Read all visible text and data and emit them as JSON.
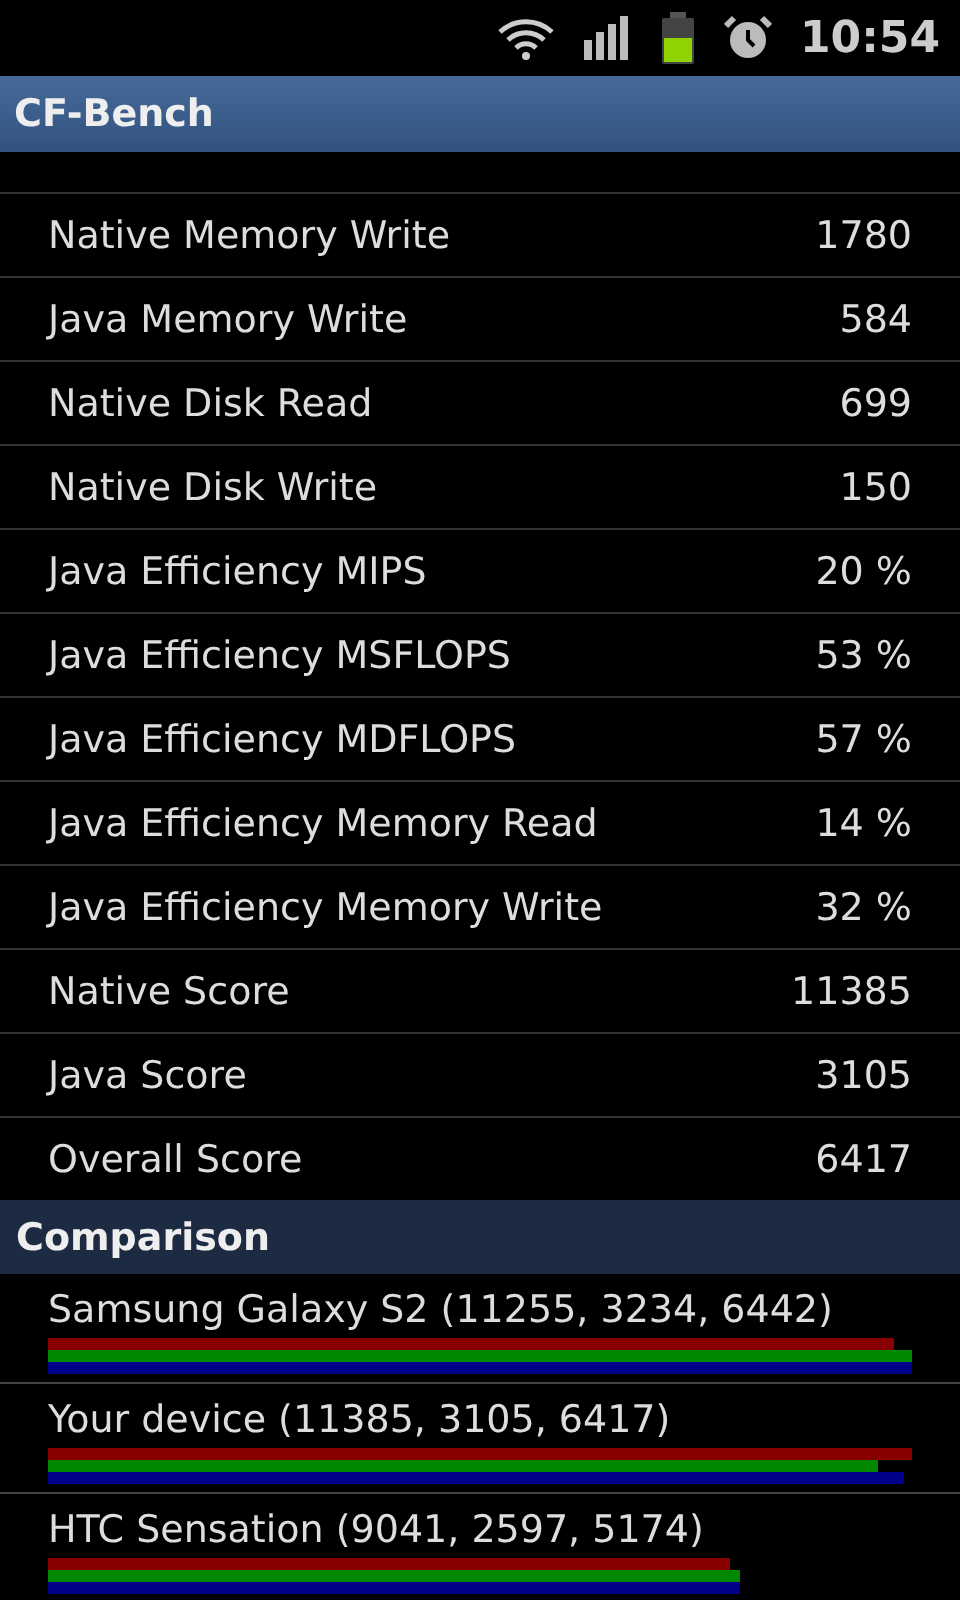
{
  "status_bar": {
    "time": "10:54"
  },
  "app_bar": {
    "title": "CF-Bench"
  },
  "results": [
    {
      "label": "Native Memory Write",
      "value": "1780"
    },
    {
      "label": "Java Memory Write",
      "value": "584"
    },
    {
      "label": "Native Disk Read",
      "value": "699"
    },
    {
      "label": "Native Disk Write",
      "value": "150"
    },
    {
      "label": "Java Efficiency MIPS",
      "value": "20 %"
    },
    {
      "label": "Java Efficiency MSFLOPS",
      "value": "53 %"
    },
    {
      "label": "Java Efficiency MDFLOPS",
      "value": "57 %"
    },
    {
      "label": "Java Efficiency Memory Read",
      "value": "14 %"
    },
    {
      "label": "Java Efficiency Memory Write",
      "value": "32 %"
    },
    {
      "label": "Native Score",
      "value": "11385"
    },
    {
      "label": "Java Score",
      "value": "3105"
    },
    {
      "label": "Overall Score",
      "value": "6417"
    }
  ],
  "comparison": {
    "title": "Comparison",
    "devices": [
      {
        "label": "Samsung Galaxy S2 (11255, 3234, 6442)",
        "bars": [
          {
            "color": "#880000"
          },
          {
            "color": "#008800"
          },
          {
            "color": "#000088"
          }
        ]
      },
      {
        "label": "Your device (11385, 3105, 6417)",
        "bars": [
          {
            "color": "#880000"
          },
          {
            "color": "#008800"
          },
          {
            "color": "#000088"
          }
        ]
      },
      {
        "label": "HTC Sensation (9041, 2597, 5174)",
        "bars": [
          {
            "color": "#880000"
          },
          {
            "color": "#008800"
          },
          {
            "color": "#000088"
          }
        ]
      }
    ]
  }
}
